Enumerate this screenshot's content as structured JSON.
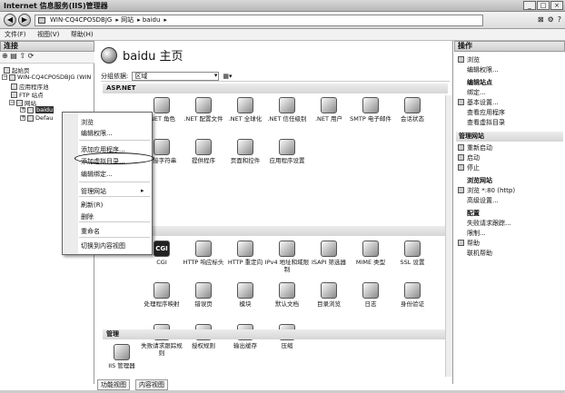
{
  "window": {
    "title": "Internet 信息服务(IIS)管理器",
    "buttons": [
      "_",
      "□",
      "×"
    ]
  },
  "address": {
    "crumbs": [
      "WIN-CQ4CPOSDBJG",
      "网站",
      "baidu"
    ],
    "tools": [
      "⊠",
      "⚙",
      "?"
    ]
  },
  "menu": [
    "文件(F)",
    "视图(V)",
    "帮助(H)"
  ],
  "left": {
    "header": "连接",
    "tree": [
      {
        "label": "起始页"
      },
      {
        "label": "WIN-CQ4CPOSDBJG (WIN"
      },
      {
        "label": "应用程序池"
      },
      {
        "label": "FTP 站点"
      },
      {
        "label": "网站"
      },
      {
        "label": "baidu"
      },
      {
        "label": "Defau"
      }
    ]
  },
  "center": {
    "title": "baidu 主页",
    "group_label": "分组依据:",
    "group_value": "区域",
    "sections": [
      "ASP.NET",
      "IIS",
      "管理"
    ],
    "aspnet": [
      ".NET 角色",
      ".NET 配置文件",
      ".NET 全球化",
      ".NET 信任级别",
      ".NET 用户",
      "SMTP 电子邮件",
      "会话状态",
      "连接字符串",
      "提供程序",
      "页面和控件",
      "应用程序设置"
    ],
    "iis": [
      "CGI",
      "HTTP 响应标头",
      "HTTP 重定向",
      "IPv4 地址和域限制",
      "ISAPI 筛选器",
      "MIME 类型",
      "SSL 设置",
      "处理程序映射",
      "错误页",
      "模块",
      "默认文档",
      "目录浏览",
      "日志",
      "身份验证",
      "失败请求跟踪规则",
      "授权规则",
      "输出缓存",
      "压缩"
    ],
    "mgmt": [
      "IIS 管理器"
    ],
    "bottom_tabs": [
      "功能视图",
      "内容视图"
    ]
  },
  "context_menu": [
    "浏览",
    "编辑权限...",
    "添加应用程序...",
    "添加虚拟目录...",
    "编辑绑定...",
    "管理网站",
    "刷新(R)",
    "删除",
    "重命名",
    "切换到内容视图"
  ],
  "right": {
    "header": "操作",
    "items": [
      {
        "t": "link",
        "text": "浏览"
      },
      {
        "t": "link",
        "text": "编辑权限..."
      },
      {
        "t": "head",
        "text": "编辑站点"
      },
      {
        "t": "link",
        "text": "绑定..."
      },
      {
        "t": "link",
        "text": "基本设置..."
      },
      {
        "t": "link",
        "text": "查看应用程序"
      },
      {
        "t": "link",
        "text": "查看虚拟目录"
      },
      {
        "t": "sec",
        "text": "管理网站"
      },
      {
        "t": "link",
        "text": "重新启动"
      },
      {
        "t": "link",
        "text": "启动"
      },
      {
        "t": "link",
        "text": "停止"
      },
      {
        "t": "head",
        "text": "浏览网站"
      },
      {
        "t": "link",
        "text": "浏览 *:80 (http)"
      },
      {
        "t": "link",
        "text": "高级设置..."
      },
      {
        "t": "head",
        "text": "配置"
      },
      {
        "t": "link",
        "text": "失败请求跟踪..."
      },
      {
        "t": "link",
        "text": "限制..."
      },
      {
        "t": "link",
        "text": "帮助"
      },
      {
        "t": "link",
        "text": "联机帮助"
      }
    ]
  }
}
